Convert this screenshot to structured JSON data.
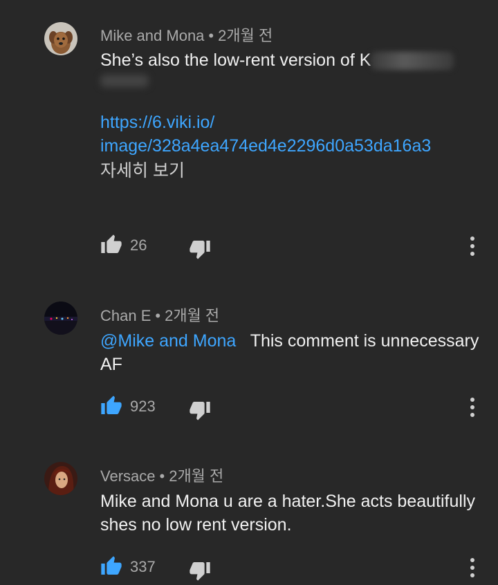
{
  "comments": [
    {
      "author": "Mike and Mona",
      "time": "2개월 전",
      "separator": "•",
      "text": "She’s also the low-rent version of K",
      "link": "https://6.viki.io/image/328a4ea474ed4e2296d0a53da16a3",
      "link_line1": "https://6.viki.io/",
      "link_line2": "image/328a4ea474ed4e2296d0a53da16a3",
      "read_more": "자세히 보기",
      "likes": "26",
      "liked": false,
      "avatar": "dog-avatar"
    },
    {
      "author": "Chan E",
      "time": "2개월 전",
      "separator": "•",
      "mention": "@Mike and Mona",
      "text": "This comment is unnecessary AF",
      "likes": "923",
      "liked": true,
      "avatar": "city-night-avatar"
    },
    {
      "author": "Versace",
      "time": "2개월 전",
      "separator": "•",
      "text": "Mike and Mona u are a hater.She acts beautifully shes no low rent version.",
      "likes": "337",
      "liked": true,
      "avatar": "character-avatar"
    }
  ],
  "colors": {
    "background": "#282828",
    "link": "#3ea6ff",
    "liked": "#3ea6ff",
    "muted": "#aaaaaa"
  },
  "icons": {
    "like": "thumbs-up-icon",
    "dislike": "thumbs-down-icon",
    "menu": "more-vert-icon"
  }
}
